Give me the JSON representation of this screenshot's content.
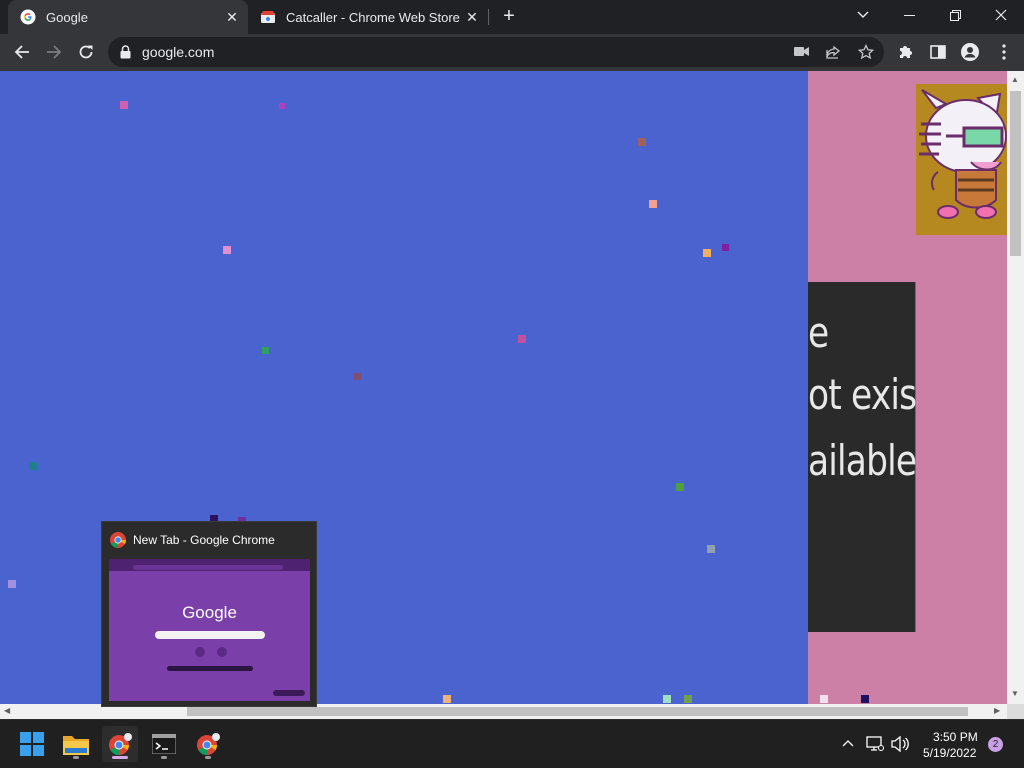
{
  "browser": {
    "tabs": [
      {
        "title": "Google",
        "active": true,
        "icon": "google-g-icon"
      },
      {
        "title": "Catcaller - Chrome Web Store",
        "active": false,
        "icon": "web-store-icon"
      }
    ],
    "address": "google.com"
  },
  "page": {
    "background_color": "#4a63cf",
    "side_color": "#cd80a5",
    "dark_panel_lines": [
      "e",
      "ot exist",
      "ailable."
    ]
  },
  "preview": {
    "title": "New Tab - Google Chrome",
    "thumb_logo": "Google"
  },
  "taskbar": {
    "time": "3:50 PM",
    "date": "5/19/2022",
    "notification_count": "2"
  }
}
